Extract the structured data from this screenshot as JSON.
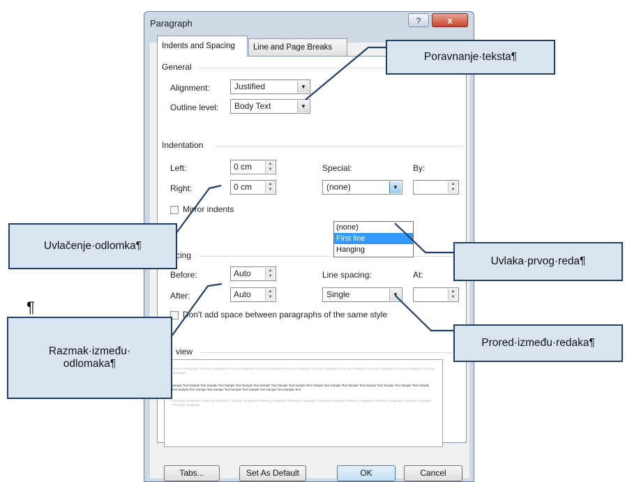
{
  "dialog": {
    "title": "Paragraph",
    "help_label": "?",
    "close_label": "x",
    "tabs": [
      {
        "label": "Indents and Spacing",
        "active": true
      },
      {
        "label": "Line and Page Breaks",
        "active": false
      }
    ],
    "general": {
      "heading": "General",
      "alignment_label": "Alignment:",
      "alignment_value": "Justified",
      "outline_label": "Outline level:",
      "outline_value": "Body Text"
    },
    "indentation": {
      "heading": "Indentation",
      "left_label": "Left:",
      "left_value": "0 cm",
      "right_label": "Right:",
      "right_value": "0 cm",
      "special_label": "Special:",
      "special_value": "(none)",
      "by_label": "By:",
      "by_value": "",
      "mirror_label": "Mirror indents",
      "special_options": [
        "(none)",
        "First line",
        "Hanging"
      ],
      "special_highlighted": "First line"
    },
    "spacing": {
      "heading_visible": "cing",
      "before_label": "Before:",
      "before_value": "Auto",
      "after_label": "After:",
      "after_value": "Auto",
      "line_spacing_label": "Line spacing:",
      "line_spacing_value": "Single",
      "at_label": "At:",
      "at_value": "",
      "dont_add_label": "Don't add space between paragraphs of the same style"
    },
    "preview": {
      "heading_visible": "view",
      "previous_text": "Previous Paragraph Previous Paragraph Previous Paragraph Previous Paragraph Previous Paragraph Previous Paragraph Previous Paragraph Previous Paragraph Previous Paragraph Previous Paragraph",
      "sample_text": "Sample Text Sample Text Sample Text Sample Text Sample Text Sample Text Sample Text Sample Text Sample Text Sample Text Sample Text Sample Text Sample Text Sample Text Sample Text Sample Text Sample Text Sample Text Sample Text Sample Text Sample Text Sample Text",
      "following_text": "Following Paragraph Following Paragraph Following Paragraph Following Paragraph Following Paragraph Following Paragraph Following Paragraph Following Paragraph Following Paragraph Following Paragraph"
    },
    "buttons": {
      "tabs": "Tabs...",
      "set_default": "Set As Default",
      "ok": "OK",
      "cancel": "Cancel"
    }
  },
  "callouts": {
    "alignment": "Poravnanje·teksta¶",
    "indent": "Uvlačenje·odlomka¶",
    "first_line": "Uvlaka·prvog·reda¶",
    "spacing_line1": "Razmak·između·",
    "spacing_line2": "odlomaka¶",
    "line_spacing": "Prored·između·redaka¶"
  },
  "pilcrow": "¶"
}
